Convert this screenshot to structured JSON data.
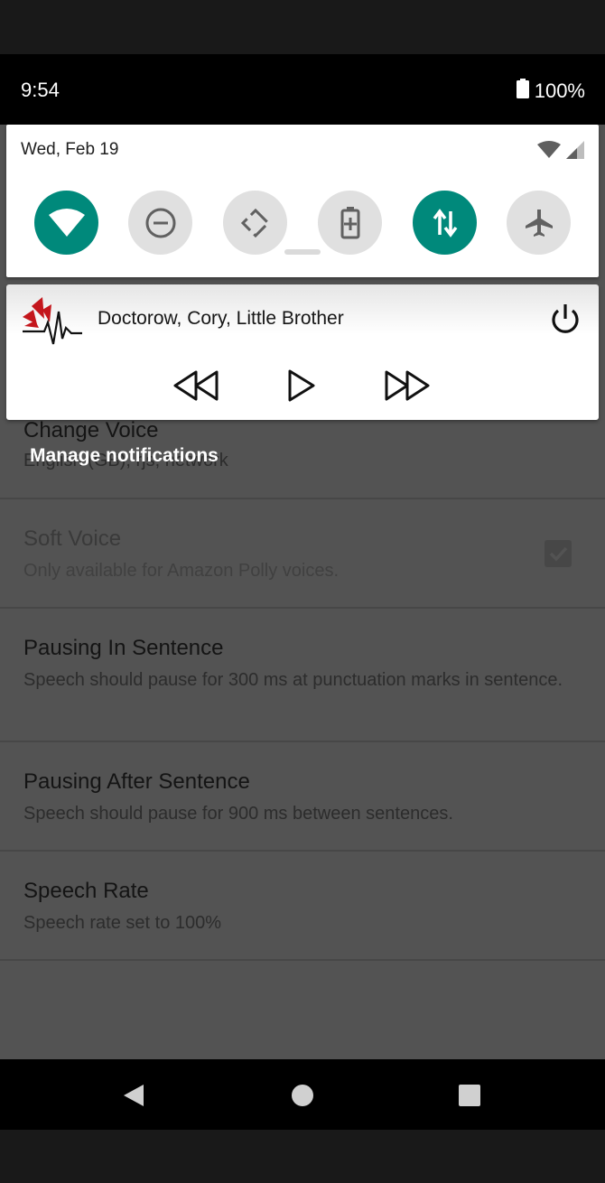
{
  "status_bar": {
    "time": "9:54",
    "battery_percent": "100%"
  },
  "quick_settings": {
    "date": "Wed, Feb 19",
    "tiles": [
      {
        "icon": "wifi-icon",
        "state": "on"
      },
      {
        "icon": "do-not-disturb-icon",
        "state": "off"
      },
      {
        "icon": "auto-rotate-icon",
        "state": "off"
      },
      {
        "icon": "battery-saver-icon",
        "state": "off"
      },
      {
        "icon": "mobile-data-icon",
        "state": "on"
      },
      {
        "icon": "airplane-mode-icon",
        "state": "off"
      }
    ]
  },
  "notification": {
    "title": "Doctorow, Cory, Little Brother",
    "controls": [
      "rewind-icon",
      "play-icon",
      "fast-forward-icon"
    ]
  },
  "manage_notifications": "Manage notifications",
  "settings": [
    {
      "title": "Change Voice",
      "summary": "English (GB), rjs, network",
      "enabled": true
    },
    {
      "title": "Soft Voice",
      "summary": "Only available for Amazon Polly voices.",
      "enabled": false,
      "checkbox": true
    },
    {
      "title": "Pausing In Sentence",
      "summary": "Speech should pause for 300 ms at punctuation marks in sentence.",
      "enabled": true
    },
    {
      "title": "Pausing After Sentence",
      "summary": "Speech should pause for 900 ms between sentences.",
      "enabled": true
    },
    {
      "title": "Speech Rate",
      "summary": "Speech rate set to 100%",
      "enabled": true
    }
  ],
  "colors": {
    "accent": "#00897b",
    "scrim": "#535353",
    "tile_off": "#e0e0e0"
  }
}
